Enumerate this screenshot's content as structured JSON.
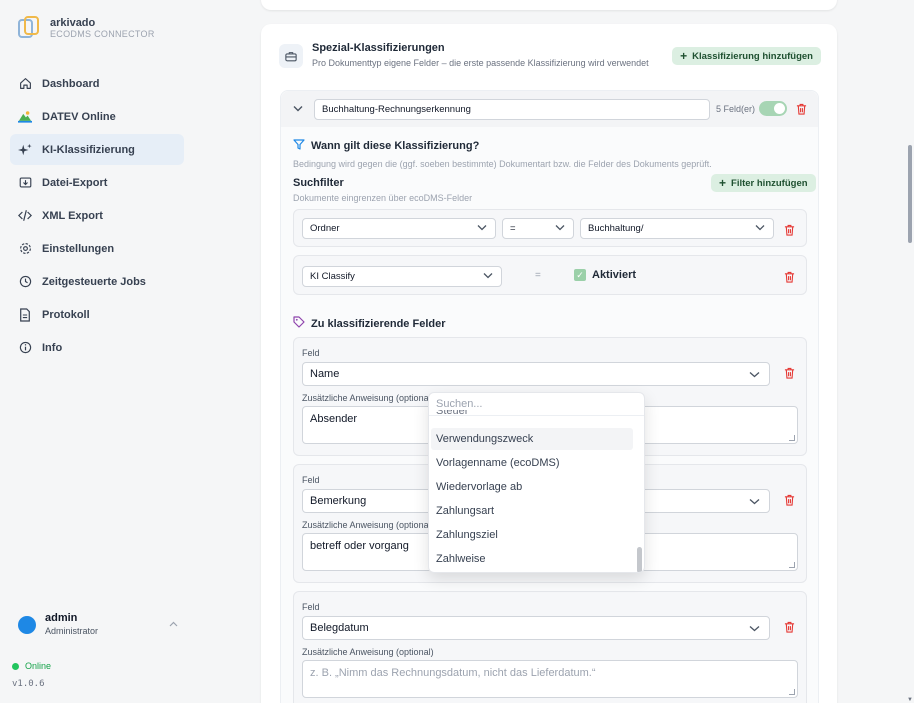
{
  "brand": {
    "name": "arkivado",
    "subtitle": "ECODMS CONNECTOR"
  },
  "nav": {
    "items": [
      {
        "label": "Dashboard",
        "icon": "home-icon"
      },
      {
        "label": "DATEV Online",
        "icon": "datev-icon"
      },
      {
        "label": "KI-Klassifizierung",
        "icon": "sparkles-icon",
        "active": true
      },
      {
        "label": "Datei-Export",
        "icon": "file-export-icon"
      },
      {
        "label": "XML Export",
        "icon": "code-icon"
      },
      {
        "label": "Einstellungen",
        "icon": "gear-icon"
      },
      {
        "label": "Zeitgesteuerte Jobs",
        "icon": "clock-icon"
      },
      {
        "label": "Protokoll",
        "icon": "document-icon"
      },
      {
        "label": "Info",
        "icon": "info-icon"
      }
    ]
  },
  "user": {
    "name": "admin",
    "role": "Administrator"
  },
  "status": {
    "label": "Online",
    "version": "v1.0.6"
  },
  "colors": {
    "accent_green": "#dcefe2",
    "avatar_blue": "#1e88e5",
    "online_green": "#22c55e",
    "trash_red": "#e53935"
  },
  "section": {
    "title": "Spezial-Klassifizierungen",
    "subtitle": "Pro Dokumenttyp eigene Felder – die erste passende Klassifizierung wird verwendet",
    "add_button": "Klassifizierung hinzufügen"
  },
  "classification": {
    "name": "Buchhaltung-Rechnungserkennung",
    "field_count": "5 Feld(er)",
    "condition_title": "Wann gilt diese Klassifizierung?",
    "condition_sub": "Bedingung wird gegen die (ggf. soeben bestimmte) Dokumentart bzw. die Felder des Dokuments geprüft.",
    "searchfilter_title": "Suchfilter",
    "searchfilter_sub": "Dokumente eingrenzen über ecoDMS-Felder",
    "add_filter_button": "Filter hinzufügen",
    "filters": [
      {
        "field": "Ordner",
        "operator": "=",
        "value": "Buchhaltung/"
      },
      {
        "field": "KI Classify",
        "operator": "=",
        "value": "Aktiviert"
      }
    ],
    "fields_title": "Zu klassifizierende Felder",
    "fields": [
      {
        "label": "Feld",
        "value": "Name",
        "hint_label": "Zusätzliche Anweisung (optional)",
        "hint": "Absender",
        "placeholder": ""
      },
      {
        "label": "Feld",
        "value": "Bemerkung",
        "hint_label": "Zusätzliche Anweisung (optional)",
        "hint": "betreff oder vorgang",
        "placeholder": ""
      },
      {
        "label": "Feld",
        "value": "Belegdatum",
        "hint_label": "Zusätzliche Anweisung (optional)",
        "hint": "",
        "placeholder": "z. B. „Nimm das Rechnungsdatum, nicht das Lieferdatum.“"
      }
    ]
  },
  "dropdown": {
    "search_placeholder": "Suchen...",
    "cut_item": "Steuer",
    "items": [
      "Verwendungszweck",
      "Vorlagenname (ecoDMS)",
      "Wiedervorlage ab",
      "Zahlungsart",
      "Zahlungsziel",
      "Zahlweise"
    ],
    "highlighted_index": 0
  }
}
